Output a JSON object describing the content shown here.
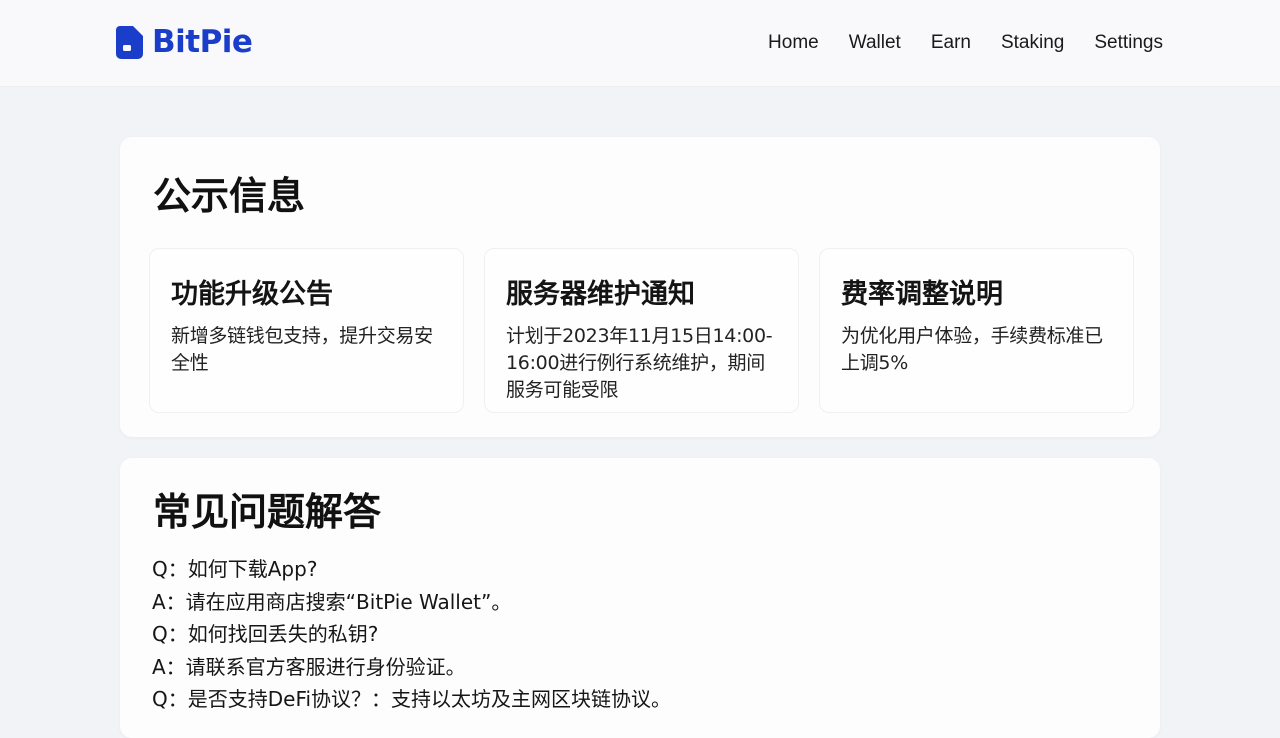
{
  "brand": {
    "name": "BitPie",
    "color": "#1a3ec9"
  },
  "nav": {
    "items": [
      "Home",
      "Wallet",
      "Earn",
      "Staking",
      "Settings"
    ]
  },
  "notices": {
    "title": "公示信息",
    "items": [
      {
        "title": "功能升级公告",
        "body": "新增多链钱包支持，提升交易安全性"
      },
      {
        "title": "服务器维护通知",
        "body": "计划于2023年11月15日14:00-16:00进行例行系统维护，期间服务可能受限"
      },
      {
        "title": "费率调整说明",
        "body": "为优化用户体验，手续费标准已上调5%"
      }
    ]
  },
  "faq": {
    "title": "常见问题解答",
    "lines": [
      "Q：如何下载App?",
      "A：请在应用商店搜索“BitPie Wallet”。",
      "Q：如何找回丢失的私钥?",
      "A：请联系官方客服进行身份验证。",
      "Q：是否支持DeFi协议？：支持以太坊及主网区块链协议。"
    ]
  }
}
